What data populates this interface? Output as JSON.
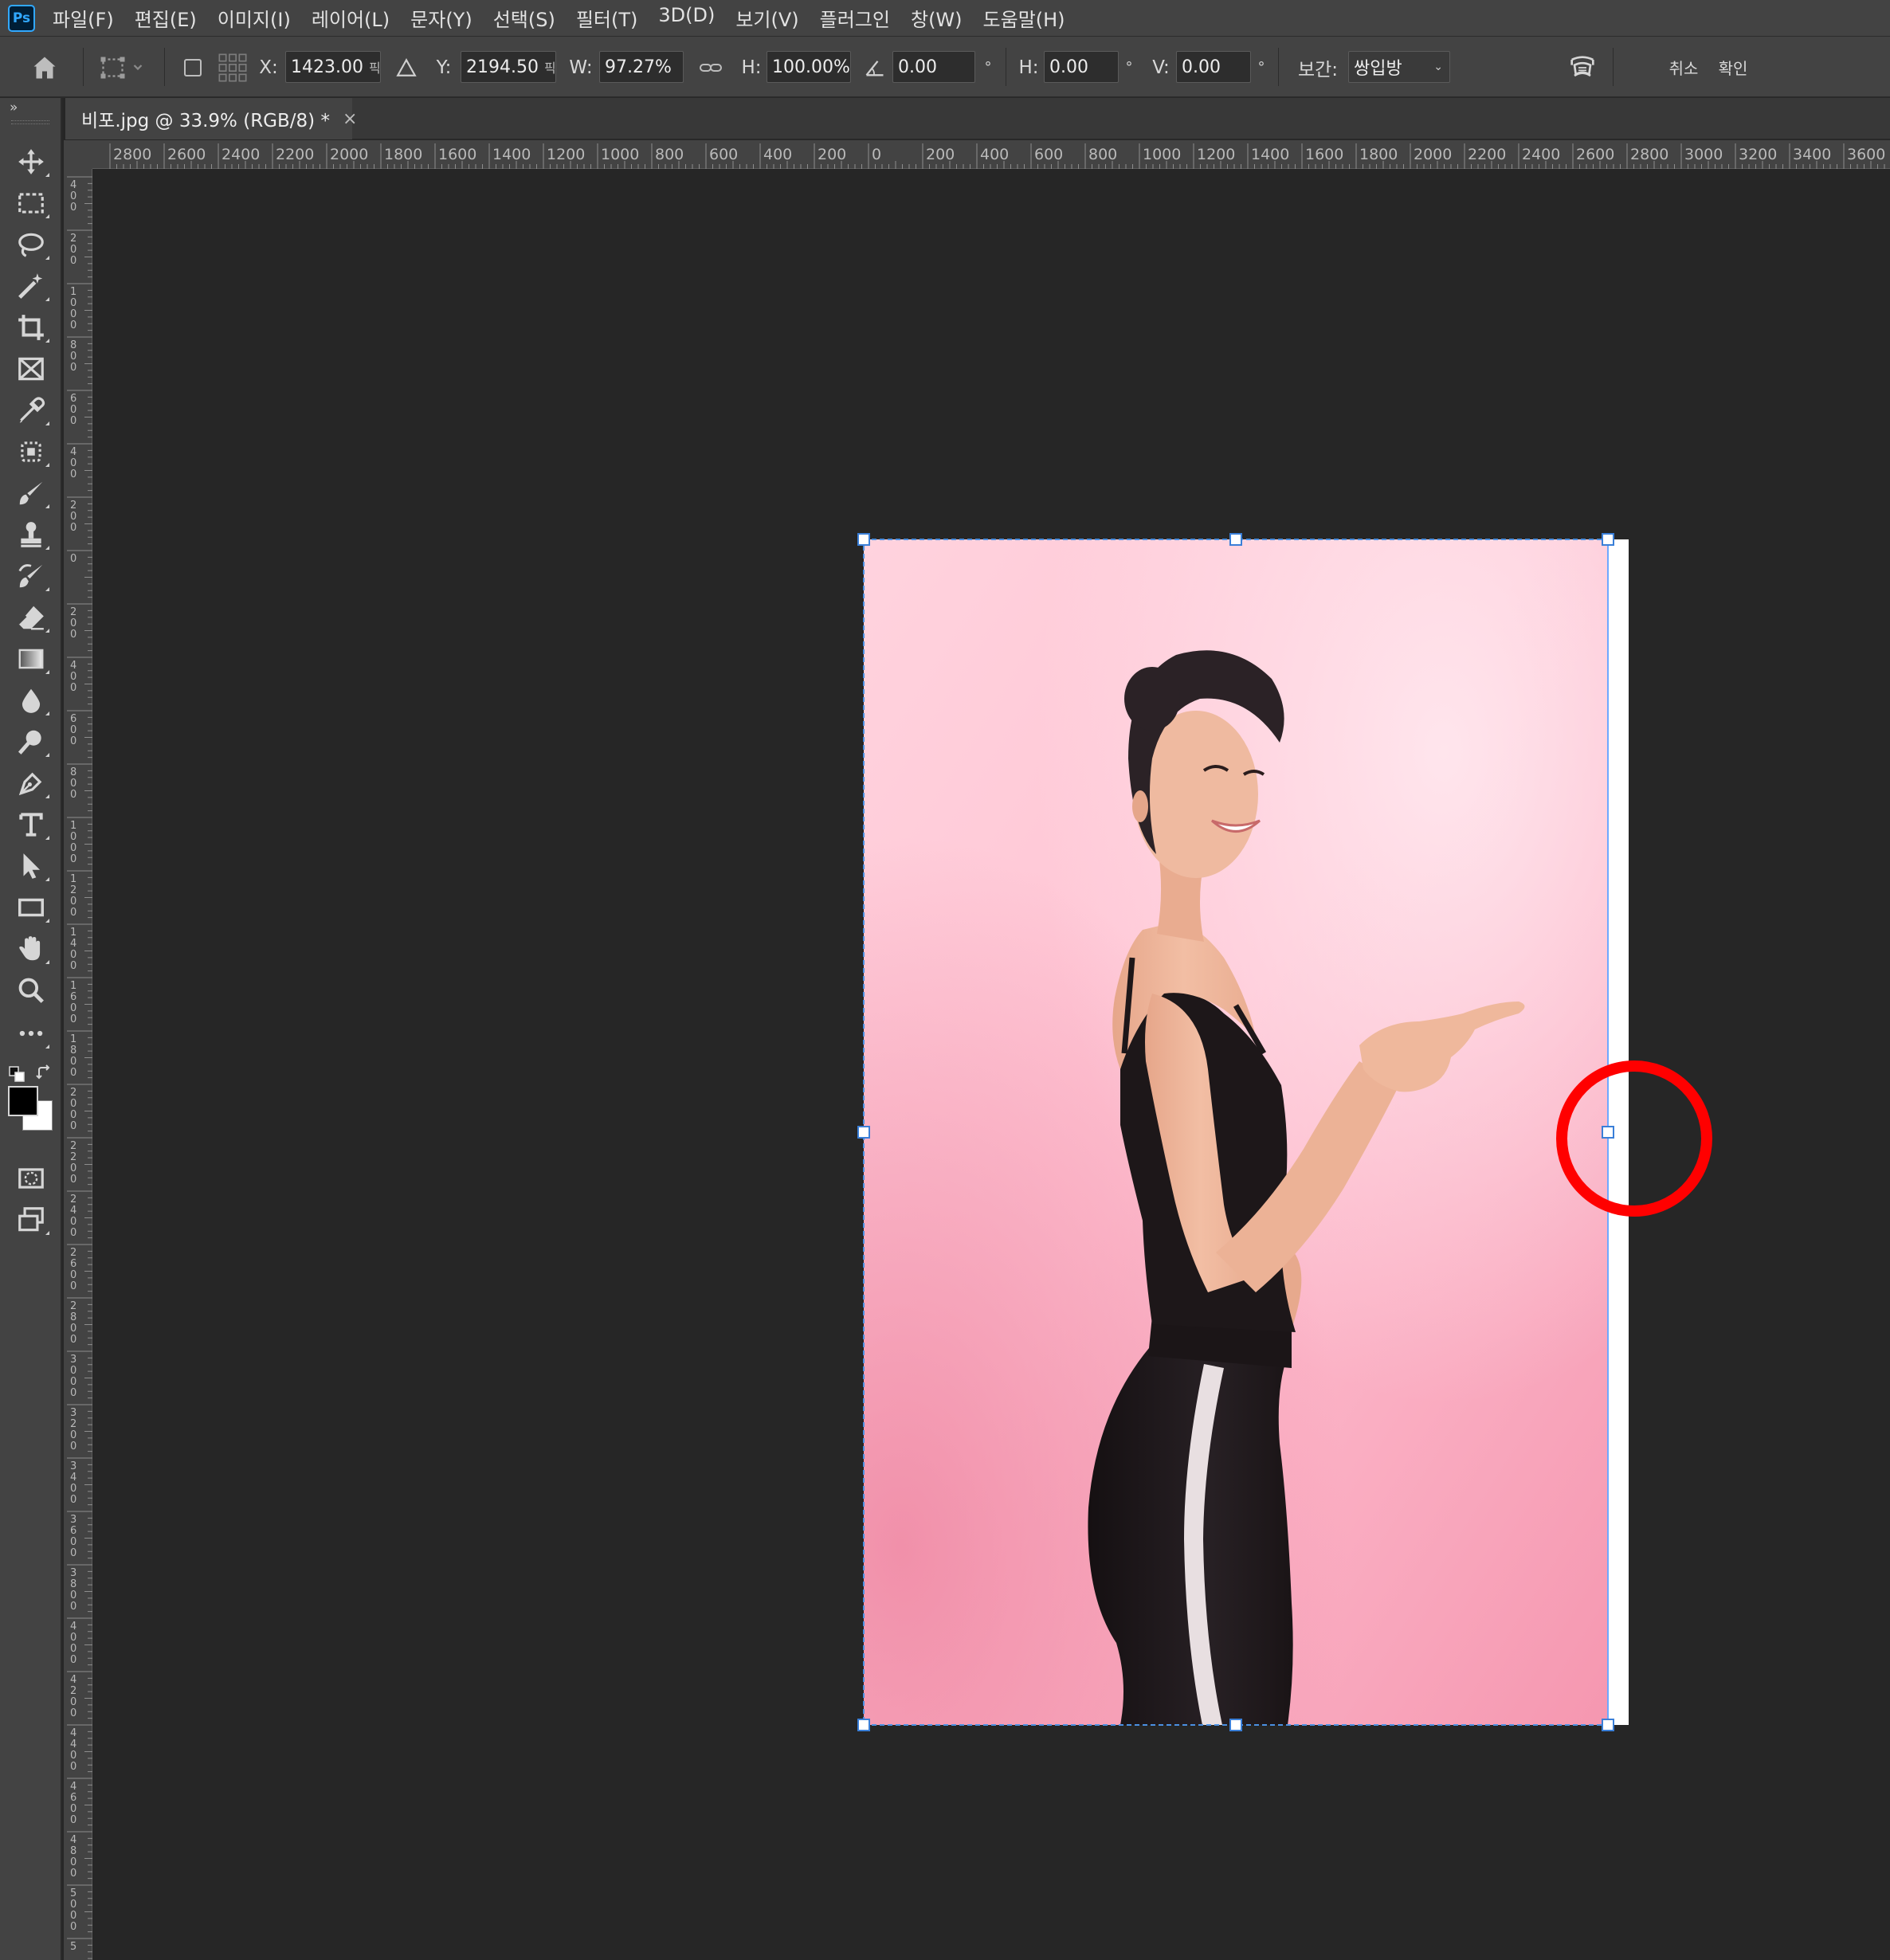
{
  "app": {
    "logo": "Ps"
  },
  "menu": [
    "파일(F)",
    "편집(E)",
    "이미지(I)",
    "레이어(L)",
    "문자(Y)",
    "선택(S)",
    "필터(T)",
    "3D(D)",
    "보기(V)",
    "플러그인",
    "창(W)",
    "도움말(H)"
  ],
  "options": {
    "x_label": "X:",
    "x_value": "1423.00",
    "x_unit": "픽",
    "y_label": "Y:",
    "y_value": "2194.50",
    "y_unit": "픽",
    "w_label": "W:",
    "w_value": "97.27%",
    "h_label": "H:",
    "h_value": "100.00%",
    "rotate_value": "0.00",
    "degree": "°",
    "skew_h_label": "H:",
    "skew_h_value": "0.00",
    "skew_v_label": "V:",
    "skew_v_value": "0.00",
    "interp_label": "보간:",
    "interp_value": "쌍입방",
    "cancel_label": "취소",
    "commit_label": "확인"
  },
  "document_tab": {
    "title": "비포.jpg @ 33.9% (RGB/8) *",
    "close": "×"
  },
  "toolbar": {
    "collapse": "»"
  },
  "ruler": {
    "h_labels": [
      "2800",
      "2600",
      "2400",
      "2200",
      "2000",
      "1800",
      "1600",
      "1400",
      "1200",
      "1000",
      "800",
      "600",
      "400",
      "200",
      "0",
      "200",
      "400",
      "600",
      "800",
      "1000",
      "1200",
      "1400",
      "1600",
      "1800",
      "2000",
      "2200",
      "2400",
      "2600",
      "2800",
      "3000",
      "3200",
      "3400",
      "3600"
    ],
    "v_labels": [
      "400",
      "200",
      "1000",
      "800",
      "600",
      "400",
      "200",
      "0",
      "200",
      "400",
      "600",
      "800",
      "1000",
      "1200",
      "1400",
      "1600",
      "1800",
      "2000",
      "2200",
      "2400",
      "2600",
      "2800",
      "3000",
      "3200",
      "3400",
      "3600",
      "3800",
      "4000",
      "4200",
      "4400",
      "4600",
      "4800",
      "5000",
      "5"
    ]
  },
  "colors": {
    "selection": "#4a90e2",
    "annotation": "#ff0000",
    "background_pink_light": "#ffdde6",
    "background_pink_deep": "#f08aa6",
    "clothing": "#1d1719",
    "skin": "#efb79b"
  },
  "icons": [
    "home-icon",
    "transform-icon",
    "move-tool-icon",
    "marquee-tool-icon",
    "lasso-tool-icon",
    "magic-wand-icon",
    "crop-tool-icon",
    "frame-tool-icon",
    "eyedropper-icon",
    "patch-tool-icon",
    "brush-tool-icon",
    "stamp-tool-icon",
    "history-brush-icon",
    "eraser-tool-icon",
    "gradient-tool-icon",
    "blur-tool-icon",
    "dodge-tool-icon",
    "pen-tool-icon",
    "type-tool-icon",
    "path-selection-icon",
    "rectangle-tool-icon",
    "hand-tool-icon",
    "zoom-tool-icon",
    "more-tools-icon",
    "warp-mode-icon"
  ]
}
